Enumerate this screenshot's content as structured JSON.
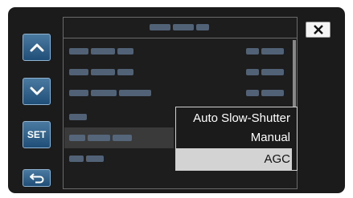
{
  "title": "",
  "side_buttons": {
    "up": "chevron-up-icon",
    "down": "chevron-down-icon",
    "set_label": "SET",
    "back": "return-icon"
  },
  "close_icon": "close-icon",
  "popup": {
    "options": [
      "Auto Slow-Shutter",
      "Manual",
      "AGC"
    ],
    "selected": "AGC"
  },
  "colors": {
    "button_blue": "#2f5f8a",
    "highlight": "#d3d3d3",
    "background": "#1b1b1b"
  }
}
